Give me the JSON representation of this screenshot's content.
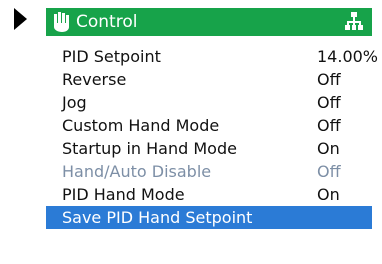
{
  "colors": {
    "header_bg": "#17a34a",
    "selection_bg": "#2b7bd6",
    "disabled_text": "#7d8fa6"
  },
  "icons": {
    "pointer": "right-triangle-arrow",
    "header_left": "hand-icon",
    "header_right": "network-icon"
  },
  "header": {
    "title": "Control"
  },
  "menu": {
    "items": [
      {
        "label": "PID Setpoint",
        "value": "14.00%"
      },
      {
        "label": "Reverse",
        "value": "Off"
      },
      {
        "label": "Jog",
        "value": "Off"
      },
      {
        "label": "Custom Hand Mode",
        "value": "Off"
      },
      {
        "label": "Startup in Hand Mode",
        "value": "On"
      },
      {
        "label": "Hand/Auto Disable",
        "value": "Off",
        "disabled": true
      },
      {
        "label": "PID Hand Mode",
        "value": "On"
      },
      {
        "label": "Save PID Hand Setpoint",
        "value": "",
        "selected": true
      }
    ]
  }
}
